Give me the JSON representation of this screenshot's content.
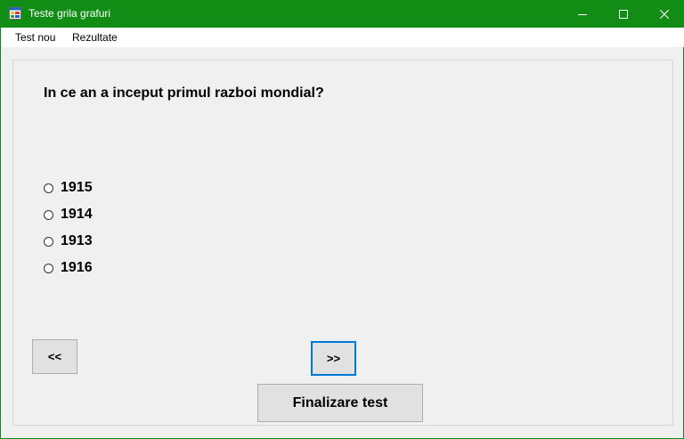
{
  "window": {
    "title": "Teste grila grafuri",
    "title_bar_color": "#118c15"
  },
  "icons": {
    "app": "app-form-icon",
    "minimize": "minimize-icon",
    "maximize": "maximize-icon",
    "close": "close-icon"
  },
  "menu": {
    "items": [
      {
        "label": "Test nou"
      },
      {
        "label": "Rezultate"
      }
    ]
  },
  "quiz": {
    "question": "In ce an a inceput primul razboi mondial?",
    "answers": [
      {
        "label": "1915",
        "selected": false
      },
      {
        "label": "1914",
        "selected": false
      },
      {
        "label": "1913",
        "selected": false
      },
      {
        "label": "1916",
        "selected": false
      }
    ]
  },
  "buttons": {
    "prev_label": "<<",
    "next_label": ">>",
    "finish_label": "Finalizare test"
  },
  "colors": {
    "focus_border": "#0078d7"
  }
}
